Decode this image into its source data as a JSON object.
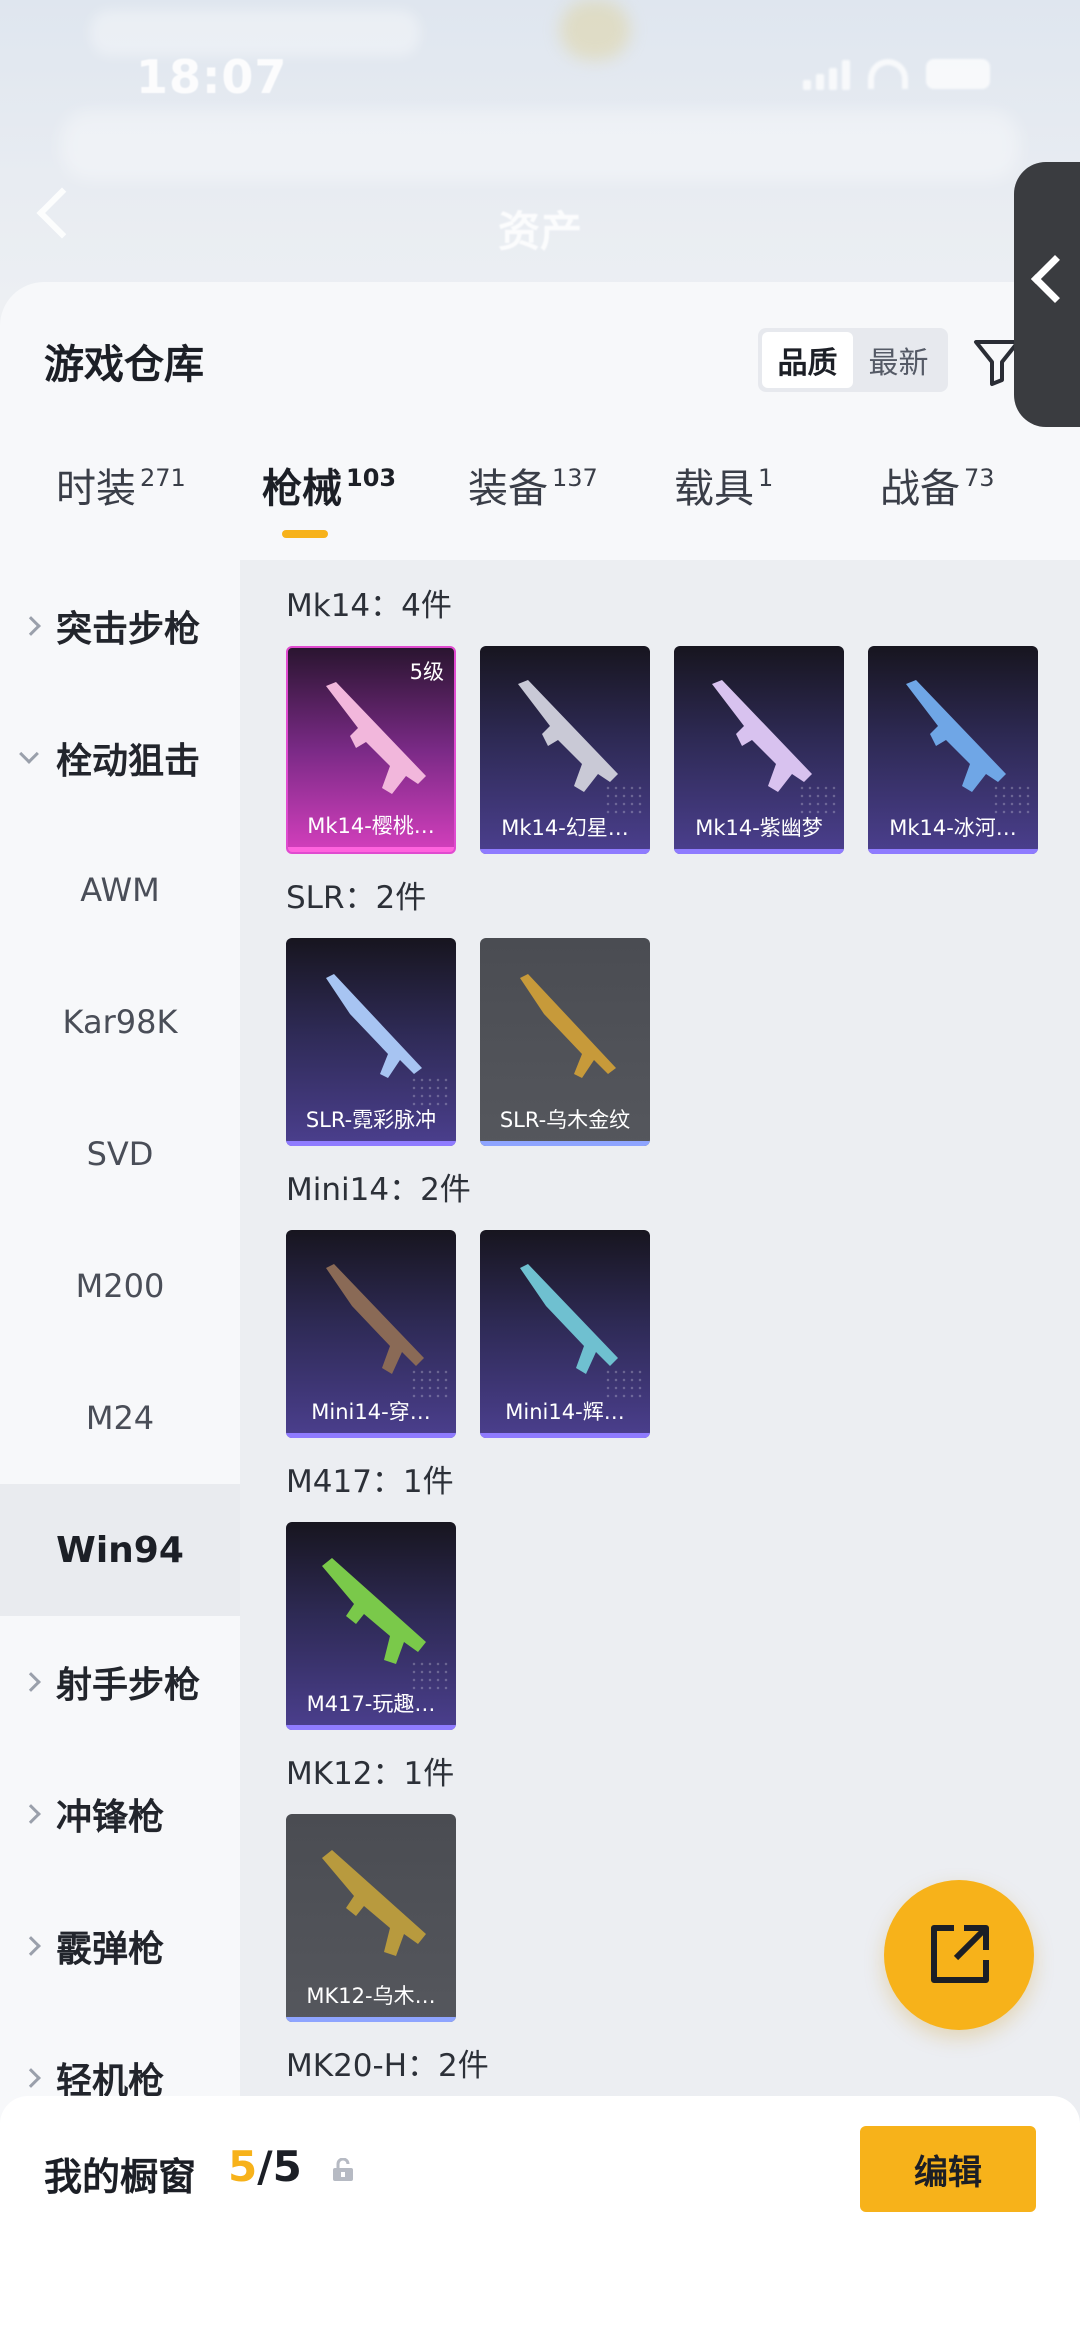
{
  "status_bar": {
    "time": "18:07"
  },
  "header": {
    "title": "资产"
  },
  "panel": {
    "title": "游戏仓库",
    "sort": {
      "options": [
        "品质",
        "最新"
      ],
      "active": "品质"
    }
  },
  "tabs": [
    {
      "label": "时装",
      "count": "271"
    },
    {
      "label": "枪械",
      "count": "103"
    },
    {
      "label": "装备",
      "count": "137"
    },
    {
      "label": "载具",
      "count": "1"
    },
    {
      "label": "战备",
      "count": "73"
    }
  ],
  "active_tab": "枪械",
  "sidebar": {
    "items": [
      {
        "label": "突击步枪",
        "type": "category",
        "expanded": false
      },
      {
        "label": "栓动狙击",
        "type": "category",
        "expanded": true
      },
      {
        "label": "AWM",
        "type": "sub"
      },
      {
        "label": "Kar98K",
        "type": "sub"
      },
      {
        "label": "SVD",
        "type": "sub"
      },
      {
        "label": "M200",
        "type": "sub"
      },
      {
        "label": "M24",
        "type": "sub"
      },
      {
        "label": "Win94",
        "type": "sub",
        "selected": true
      },
      {
        "label": "射手步枪",
        "type": "category",
        "expanded": false
      },
      {
        "label": "冲锋枪",
        "type": "category",
        "expanded": false
      },
      {
        "label": "霰弹枪",
        "type": "category",
        "expanded": false
      },
      {
        "label": "轻机枪",
        "type": "category",
        "expanded": false
      }
    ]
  },
  "groups": [
    {
      "title": "Mk14：4件",
      "items": [
        {
          "name": "Mk14-樱桃…",
          "level": "5级",
          "rarity": "pink"
        },
        {
          "name": "Mk14-幻星…",
          "rarity": "purple"
        },
        {
          "name": "Mk14-紫幽梦",
          "rarity": "purple"
        },
        {
          "name": "Mk14-冰河…",
          "rarity": "purple"
        }
      ]
    },
    {
      "title": "SLR：2件",
      "items": [
        {
          "name": "SLR-霓彩脉冲",
          "rarity": "purple"
        },
        {
          "name": "SLR-乌木金纹",
          "rarity": "gray"
        }
      ]
    },
    {
      "title": "Mini14：2件",
      "items": [
        {
          "name": "Mini14-穿…",
          "rarity": "purple"
        },
        {
          "name": "Mini14-辉…",
          "rarity": "purple"
        }
      ]
    },
    {
      "title": "M417：1件",
      "items": [
        {
          "name": "M417-玩趣…",
          "rarity": "purple"
        }
      ]
    },
    {
      "title": "MK12：1件",
      "items": [
        {
          "name": "MK12-乌木…",
          "rarity": "gray"
        }
      ]
    },
    {
      "title": "MK20-H：2件",
      "items": []
    }
  ],
  "colors": {
    "accent": "#f7b21a",
    "rare_pink": "#d43fbd",
    "rare_purple": "#4b3f8e",
    "common_gray": "#55575d"
  },
  "bottom_bar": {
    "showcase_label": "我的橱窗",
    "showcase_current": "5",
    "showcase_total": "/5",
    "edit_label": "编辑"
  }
}
